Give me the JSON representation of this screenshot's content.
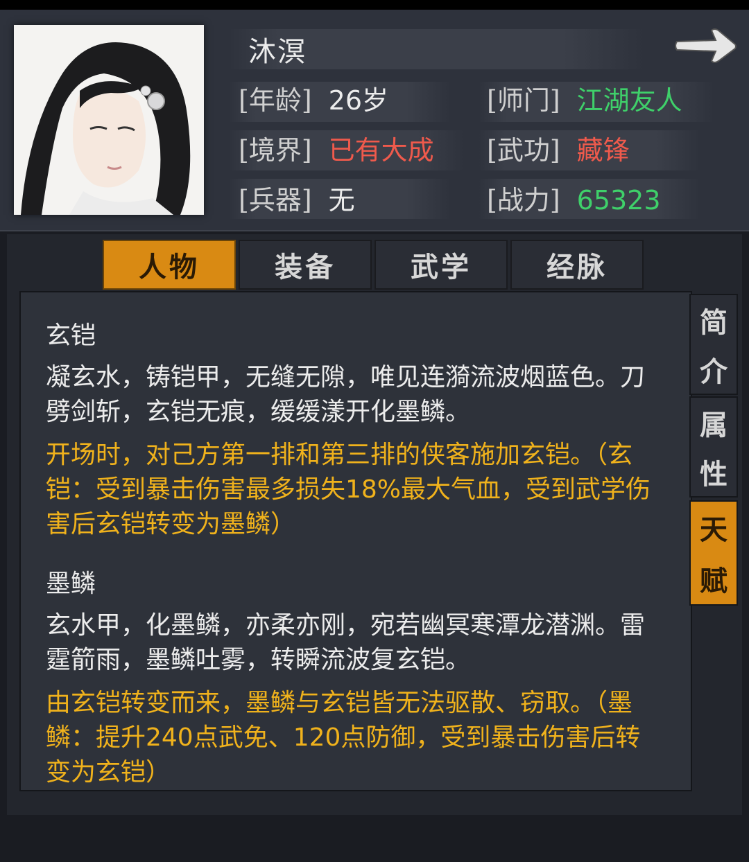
{
  "character": {
    "name": "沐溟",
    "age_label": "[年龄]",
    "age_value": "26岁",
    "realm_label": "[境界]",
    "realm_value": "已有大成",
    "weapon_label": "[兵器]",
    "weapon_value": "无",
    "sect_label": "[师门]",
    "sect_value": "江湖友人",
    "martial_label": "[武功]",
    "martial_value": "藏锋",
    "power_label": "[战力]",
    "power_value": "65323"
  },
  "colors": {
    "green": "#3fd06a",
    "red": "#ef5a4c",
    "orange": "#f0b21c",
    "accent": "#d98a13"
  },
  "tabs": [
    {
      "label": "人物",
      "active": true
    },
    {
      "label": "装备",
      "active": false
    },
    {
      "label": "武学",
      "active": false
    },
    {
      "label": "经脉",
      "active": false
    }
  ],
  "side_tabs": [
    {
      "label1": "简",
      "label2": "介"
    },
    {
      "label1": "属",
      "label2": "性"
    },
    {
      "label1": "天",
      "label2": "赋",
      "active": true
    }
  ],
  "talents": [
    {
      "title": "玄铠",
      "desc": "凝玄水，铸铠甲，无缝无隙，唯见连漪流波烟蓝色。刀劈剑斩，玄铠无痕，缓缓漾开化墨鳞。",
      "effect": "开场时，对己方第一排和第三排的侠客施加玄铠。（玄铠：受到暴击伤害最多损失18%最大气血，受到武学伤害后玄铠转变为墨鳞）"
    },
    {
      "title": "墨鳞",
      "desc": "玄水甲，化墨鳞，亦柔亦刚，宛若幽冥寒潭龙潜渊。雷霆箭雨，墨鳞吐雾，转瞬流波复玄铠。",
      "effect": "由玄铠转变而来，墨鳞与玄铠皆无法驱散、窃取。（墨鳞：提升240点武免、120点防御，受到暴击伤害后转变为玄铠）"
    }
  ],
  "icons": {
    "next": "arrow-right-icon",
    "portrait": "character-portrait"
  }
}
